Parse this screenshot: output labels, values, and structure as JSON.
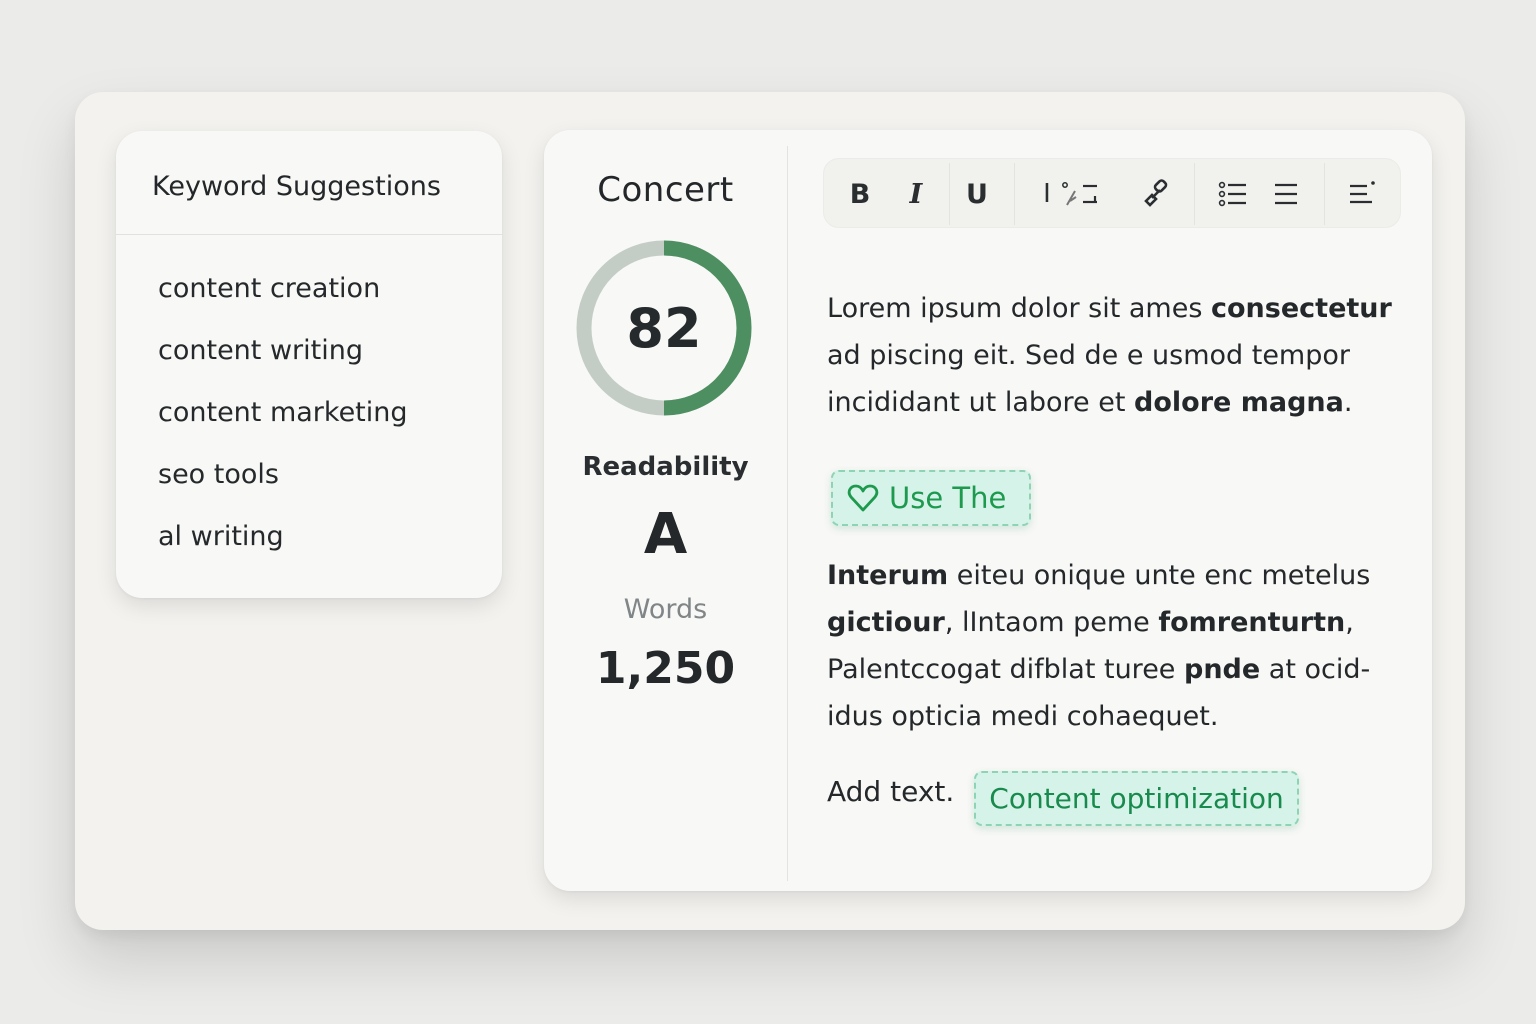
{
  "keyword_panel": {
    "title": "Keyword Suggestions",
    "items": [
      "content creation",
      "content writing",
      "content marketing",
      "seo tools",
      "al writing"
    ]
  },
  "metrics": {
    "doc_title": "Concert",
    "score": "82",
    "score_fraction": 0.5,
    "readability_label": "Readability",
    "readability_grade": "A",
    "words_label": "Words",
    "words_value": "1,250"
  },
  "toolbar": {
    "bold_label": "B",
    "italic_label": "I",
    "underline_label": "U",
    "cursor_label": "I"
  },
  "editor": {
    "para1": {
      "l1a": "Lorem ipsum dolor sit ames ",
      "l1b": "consectetur",
      "l2": "ad piscing eit.  Sed de e usmod tempor",
      "l3a": "incididant ut labore et ",
      "l3b": "dolore magna",
      "l3c": "."
    },
    "suggestion_chip": "Use The",
    "para2": {
      "l1a": "Interum",
      "l1b": " eiteu onique unte enc metelus",
      "l2a": "gictiour",
      "l2b": ", lIntaom peme ",
      "l2c": "fomrenturtn",
      "l2d": ",",
      "l3a": "Palentccogat difblat turee ",
      "l3b": "pnde",
      "l3c": " at ocid-",
      "l4": "idus opticia medi cohaequet."
    },
    "add_text": "Add text.",
    "optimization_chip": "Content optimization"
  },
  "colors": {
    "accent_green": "#4e8f62",
    "ring_track": "#c3cdc6",
    "chip_bg": "#d6f3ea",
    "chip_text": "#188a4d"
  }
}
